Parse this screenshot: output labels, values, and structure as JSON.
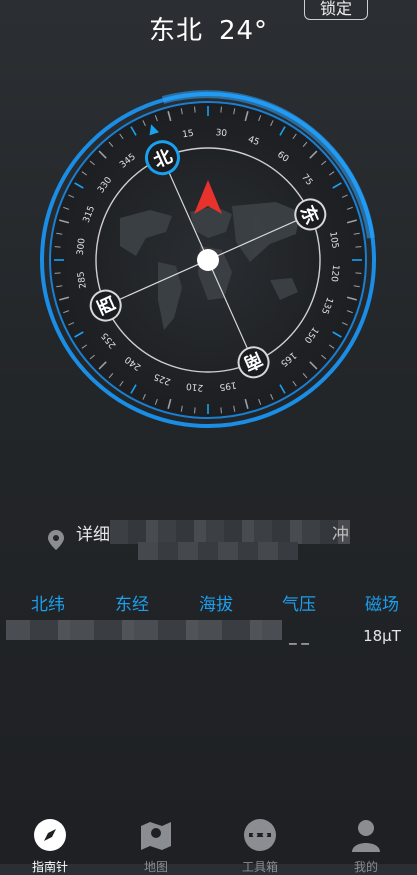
{
  "header": {
    "direction": "东北",
    "degree": "24°",
    "lock_label": "锁定"
  },
  "compass": {
    "cardinals": {
      "north": "北",
      "east": "东",
      "south": "南",
      "west": "西"
    },
    "heading_degrees": 24,
    "ticks": [
      "15",
      "30",
      "45",
      "60",
      "75",
      "105",
      "120",
      "135",
      "150",
      "165",
      "195",
      "210",
      "225",
      "240",
      "255",
      "285",
      "300",
      "315",
      "330",
      "345"
    ]
  },
  "location": {
    "prefix": "详细",
    "suffix": "冲"
  },
  "stats": [
    {
      "label": "北纬",
      "value": ""
    },
    {
      "label": "东经",
      "value": ""
    },
    {
      "label": "海拔",
      "value": ""
    },
    {
      "label": "气压",
      "value": "_ _"
    },
    {
      "label": "磁场",
      "value": "18μT"
    }
  ],
  "tabs": [
    {
      "label": "指南针",
      "icon": "compass-icon",
      "active": true
    },
    {
      "label": "地图",
      "icon": "map-icon",
      "active": false
    },
    {
      "label": "工具箱",
      "icon": "toolbox-icon",
      "active": false
    },
    {
      "label": "我的",
      "icon": "profile-icon",
      "active": false
    }
  ],
  "colors": {
    "accent": "#1aa0ee",
    "needle": "#e8322c"
  }
}
